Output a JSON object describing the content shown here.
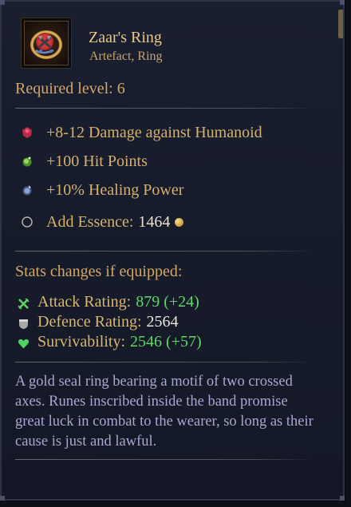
{
  "item": {
    "name": "Zaar's Ring",
    "type": "Artefact, Ring",
    "icon": "axe-ring-icon"
  },
  "requirement": {
    "text": "Required level: 6"
  },
  "affixes": [
    {
      "text": "+8-12 Damage against Humanoid",
      "icon": "red-gem-icon",
      "color": "#c02a4a"
    },
    {
      "text": "+100 Hit Points",
      "icon": "green-gem-icon",
      "color": "#6fbf3a"
    },
    {
      "text": "+10% Healing Power",
      "icon": "blue-gem-icon",
      "color": "#6f86c9"
    }
  ],
  "essence": {
    "label": "Add Essence:",
    "value": "1464",
    "icon": "empty-slot-icon",
    "currency_icon": "gold-coin-icon"
  },
  "stats": {
    "title": "Stats changes if equipped:",
    "rows": [
      {
        "label": "Attack Rating:",
        "value": "879 (+24)",
        "icon": "crossed-swords-icon",
        "color": "#5fd66a"
      },
      {
        "label": "Defence Rating:",
        "value": "2564",
        "icon": "shield-icon",
        "color": "#ece6d8"
      },
      {
        "label": "Survivability:",
        "value": "2546 (+57)",
        "icon": "heart-icon",
        "color": "#5fd66a"
      }
    ]
  },
  "description": "A gold seal ring bearing a motif of two crossed axes. Runes inscribed inside the band promise great luck in combat to the wearer, so long as their cause is just and lawful."
}
